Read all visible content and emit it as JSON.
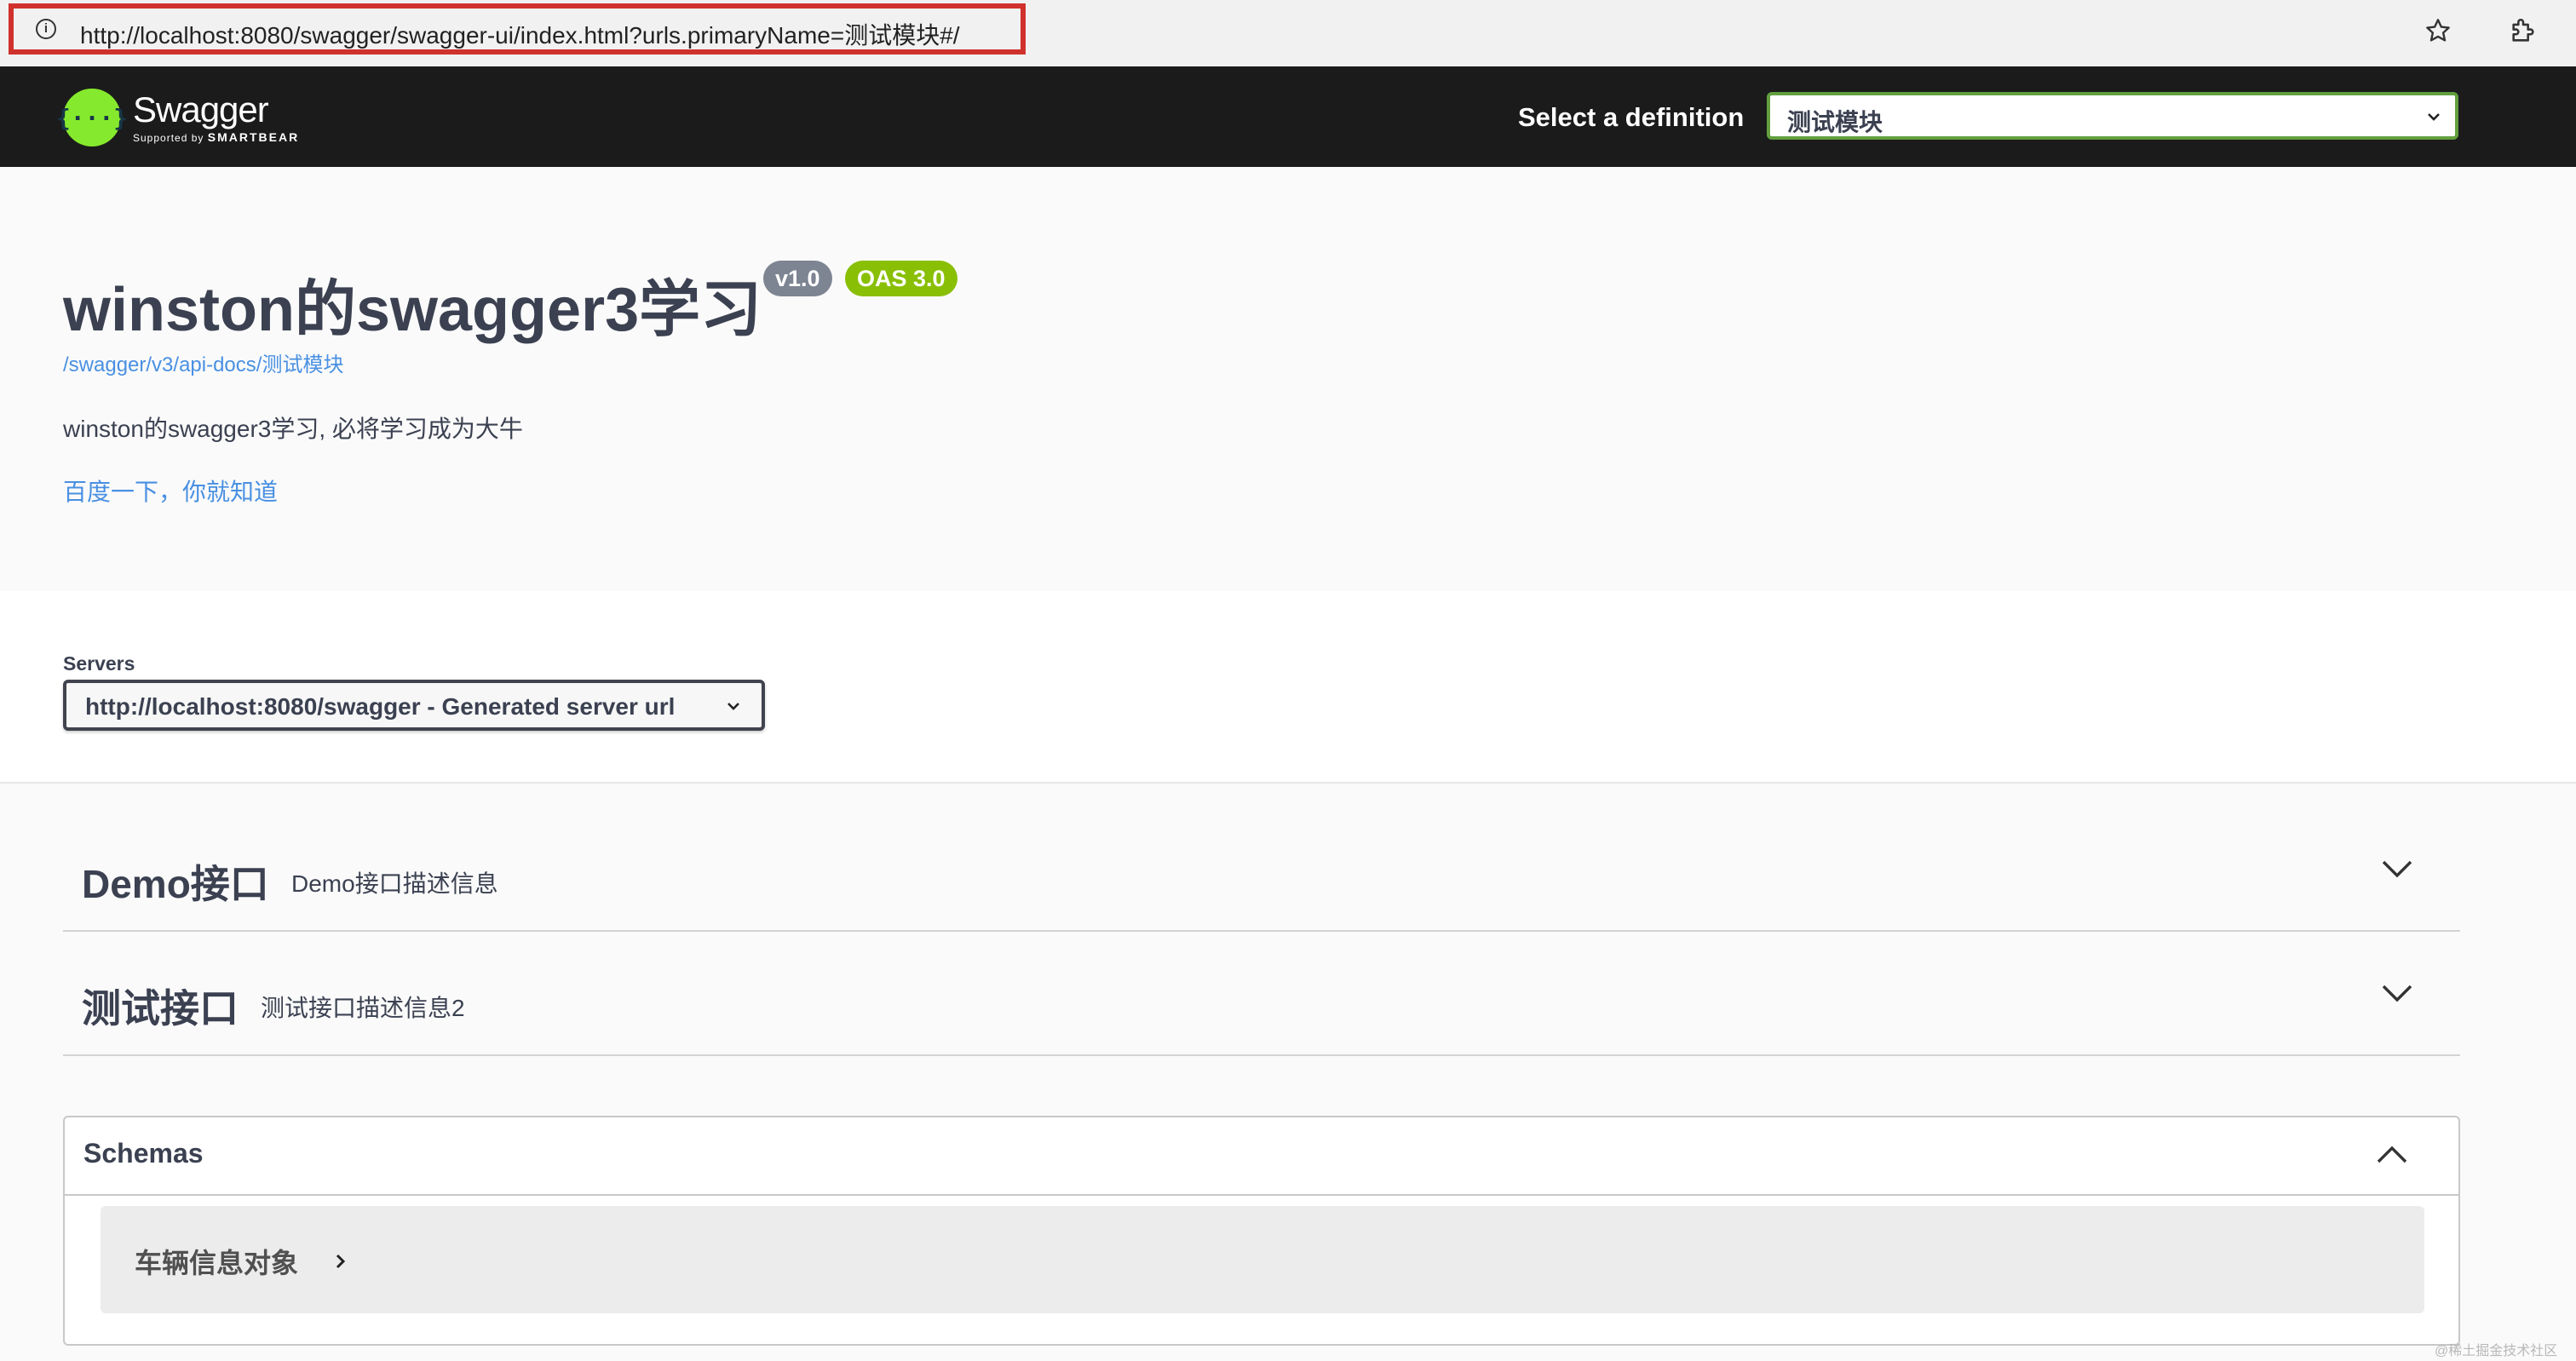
{
  "browser": {
    "url": "http://localhost:8080/swagger/swagger-ui/index.html?urls.primaryName=测试模块#/",
    "info_glyph": "i",
    "icons": [
      "info-icon",
      "star-icon",
      "extension-icon"
    ]
  },
  "topbar": {
    "logo_mark": "{···}",
    "logo_name": "Swagger",
    "logo_supported": "Supported by",
    "logo_brand": "SMARTBEAR",
    "definition_label": "Select a definition",
    "definition_value": "测试模块"
  },
  "info": {
    "title": "winston的swagger3学习",
    "version": "v1.0",
    "oas": "OAS 3.0",
    "api_link": "/swagger/v3/api-docs/测试模块",
    "description": "winston的swagger3学习, 必将学习成为大牛",
    "external_link": "百度一下，你就知道"
  },
  "servers": {
    "label": "Servers",
    "selected": "http://localhost:8080/swagger - Generated server url"
  },
  "tags": [
    {
      "name": "Demo接口",
      "description": "Demo接口描述信息",
      "expanded": false
    },
    {
      "name": "测试接口",
      "description": "测试接口描述信息2",
      "expanded": false
    }
  ],
  "schemas": {
    "title": "Schemas",
    "expanded": true,
    "models": [
      {
        "name": "车辆信息对象"
      }
    ]
  },
  "watermark": "@稀土掘金技术社区",
  "colors": {
    "topbar_bg": "#1b1b1b",
    "logo_green": "#85ea2d",
    "select_border": "#62a03f",
    "badge_version": "#7d8492",
    "badge_oas": "#89bf04",
    "link": "#4990e2",
    "url_highlight": "#d0312d"
  }
}
